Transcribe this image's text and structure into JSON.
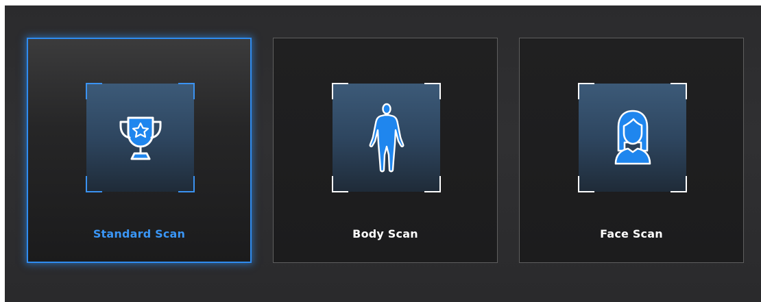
{
  "scan_modes": [
    {
      "label": "Standard Scan",
      "icon": "trophy-icon",
      "selected": true
    },
    {
      "label": "Body Scan",
      "icon": "human-body-icon",
      "selected": false
    },
    {
      "label": "Face Scan",
      "icon": "face-portrait-icon",
      "selected": false
    }
  ],
  "colors": {
    "accent": "#2f8cf0",
    "icon_fill": "#1f86ee",
    "panel_bg": "#2d2d2f",
    "card_border": "#5f5f5f"
  }
}
